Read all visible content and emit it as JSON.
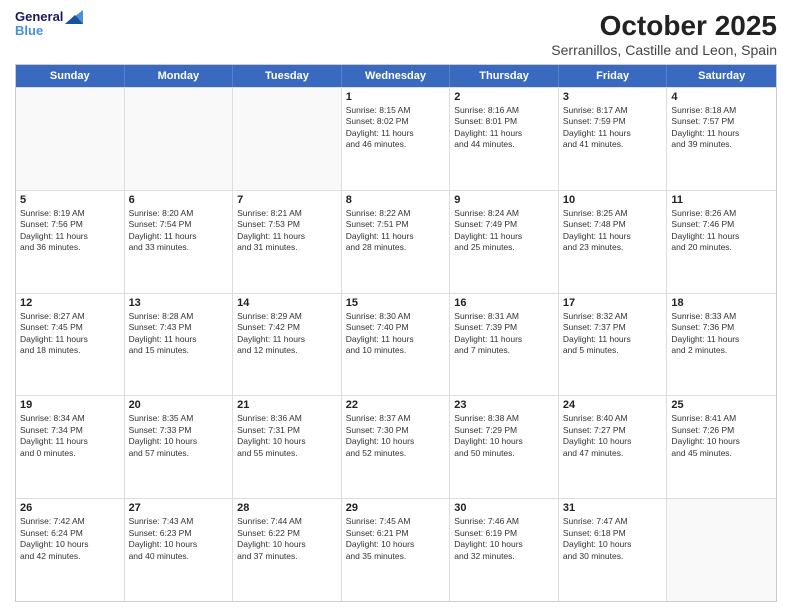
{
  "logo": {
    "line1": "General",
    "line2": "Blue"
  },
  "title": "October 2025",
  "subtitle": "Serranillos, Castille and Leon, Spain",
  "header_days": [
    "Sunday",
    "Monday",
    "Tuesday",
    "Wednesday",
    "Thursday",
    "Friday",
    "Saturday"
  ],
  "weeks": [
    [
      {
        "day": "",
        "info": ""
      },
      {
        "day": "",
        "info": ""
      },
      {
        "day": "",
        "info": ""
      },
      {
        "day": "1",
        "info": "Sunrise: 8:15 AM\nSunset: 8:02 PM\nDaylight: 11 hours\nand 46 minutes."
      },
      {
        "day": "2",
        "info": "Sunrise: 8:16 AM\nSunset: 8:01 PM\nDaylight: 11 hours\nand 44 minutes."
      },
      {
        "day": "3",
        "info": "Sunrise: 8:17 AM\nSunset: 7:59 PM\nDaylight: 11 hours\nand 41 minutes."
      },
      {
        "day": "4",
        "info": "Sunrise: 8:18 AM\nSunset: 7:57 PM\nDaylight: 11 hours\nand 39 minutes."
      }
    ],
    [
      {
        "day": "5",
        "info": "Sunrise: 8:19 AM\nSunset: 7:56 PM\nDaylight: 11 hours\nand 36 minutes."
      },
      {
        "day": "6",
        "info": "Sunrise: 8:20 AM\nSunset: 7:54 PM\nDaylight: 11 hours\nand 33 minutes."
      },
      {
        "day": "7",
        "info": "Sunrise: 8:21 AM\nSunset: 7:53 PM\nDaylight: 11 hours\nand 31 minutes."
      },
      {
        "day": "8",
        "info": "Sunrise: 8:22 AM\nSunset: 7:51 PM\nDaylight: 11 hours\nand 28 minutes."
      },
      {
        "day": "9",
        "info": "Sunrise: 8:24 AM\nSunset: 7:49 PM\nDaylight: 11 hours\nand 25 minutes."
      },
      {
        "day": "10",
        "info": "Sunrise: 8:25 AM\nSunset: 7:48 PM\nDaylight: 11 hours\nand 23 minutes."
      },
      {
        "day": "11",
        "info": "Sunrise: 8:26 AM\nSunset: 7:46 PM\nDaylight: 11 hours\nand 20 minutes."
      }
    ],
    [
      {
        "day": "12",
        "info": "Sunrise: 8:27 AM\nSunset: 7:45 PM\nDaylight: 11 hours\nand 18 minutes."
      },
      {
        "day": "13",
        "info": "Sunrise: 8:28 AM\nSunset: 7:43 PM\nDaylight: 11 hours\nand 15 minutes."
      },
      {
        "day": "14",
        "info": "Sunrise: 8:29 AM\nSunset: 7:42 PM\nDaylight: 11 hours\nand 12 minutes."
      },
      {
        "day": "15",
        "info": "Sunrise: 8:30 AM\nSunset: 7:40 PM\nDaylight: 11 hours\nand 10 minutes."
      },
      {
        "day": "16",
        "info": "Sunrise: 8:31 AM\nSunset: 7:39 PM\nDaylight: 11 hours\nand 7 minutes."
      },
      {
        "day": "17",
        "info": "Sunrise: 8:32 AM\nSunset: 7:37 PM\nDaylight: 11 hours\nand 5 minutes."
      },
      {
        "day": "18",
        "info": "Sunrise: 8:33 AM\nSunset: 7:36 PM\nDaylight: 11 hours\nand 2 minutes."
      }
    ],
    [
      {
        "day": "19",
        "info": "Sunrise: 8:34 AM\nSunset: 7:34 PM\nDaylight: 11 hours\nand 0 minutes."
      },
      {
        "day": "20",
        "info": "Sunrise: 8:35 AM\nSunset: 7:33 PM\nDaylight: 10 hours\nand 57 minutes."
      },
      {
        "day": "21",
        "info": "Sunrise: 8:36 AM\nSunset: 7:31 PM\nDaylight: 10 hours\nand 55 minutes."
      },
      {
        "day": "22",
        "info": "Sunrise: 8:37 AM\nSunset: 7:30 PM\nDaylight: 10 hours\nand 52 minutes."
      },
      {
        "day": "23",
        "info": "Sunrise: 8:38 AM\nSunset: 7:29 PM\nDaylight: 10 hours\nand 50 minutes."
      },
      {
        "day": "24",
        "info": "Sunrise: 8:40 AM\nSunset: 7:27 PM\nDaylight: 10 hours\nand 47 minutes."
      },
      {
        "day": "25",
        "info": "Sunrise: 8:41 AM\nSunset: 7:26 PM\nDaylight: 10 hours\nand 45 minutes."
      }
    ],
    [
      {
        "day": "26",
        "info": "Sunrise: 7:42 AM\nSunset: 6:24 PM\nDaylight: 10 hours\nand 42 minutes."
      },
      {
        "day": "27",
        "info": "Sunrise: 7:43 AM\nSunset: 6:23 PM\nDaylight: 10 hours\nand 40 minutes."
      },
      {
        "day": "28",
        "info": "Sunrise: 7:44 AM\nSunset: 6:22 PM\nDaylight: 10 hours\nand 37 minutes."
      },
      {
        "day": "29",
        "info": "Sunrise: 7:45 AM\nSunset: 6:21 PM\nDaylight: 10 hours\nand 35 minutes."
      },
      {
        "day": "30",
        "info": "Sunrise: 7:46 AM\nSunset: 6:19 PM\nDaylight: 10 hours\nand 32 minutes."
      },
      {
        "day": "31",
        "info": "Sunrise: 7:47 AM\nSunset: 6:18 PM\nDaylight: 10 hours\nand 30 minutes."
      },
      {
        "day": "",
        "info": ""
      }
    ]
  ]
}
